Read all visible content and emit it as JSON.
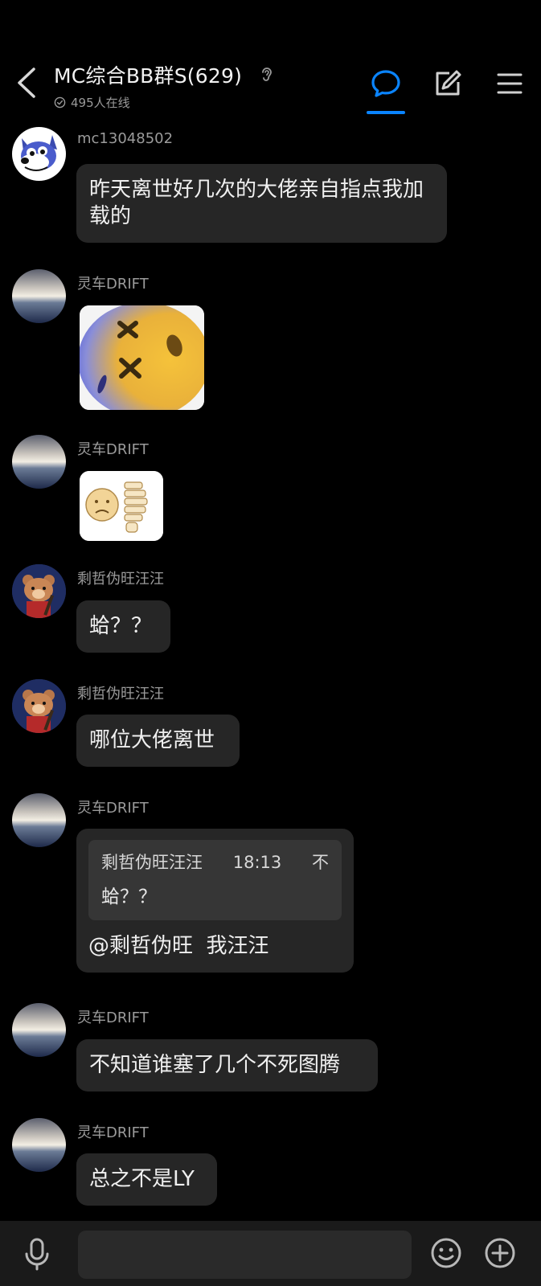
{
  "header": {
    "title": "MC综合BB群S(629)",
    "online": "495人在线"
  },
  "messages": [
    {
      "nick": "mc13048502",
      "text": "昨天离世好几次的大佬亲自指点我加载的"
    },
    {
      "nick": "灵车DRIFT",
      "sticker": "dead-face-emoji-sticker"
    },
    {
      "nick": "灵车DRIFT",
      "sticker": "skeleton-face-sticker"
    },
    {
      "nick": "剩哲伪旺汪汪",
      "text": "蛤？？"
    },
    {
      "nick": "剩哲伪旺汪汪",
      "text": "哪位大佬离世"
    },
    {
      "nick": "灵车DRIFT",
      "quote": {
        "author": "剩哲伪旺汪汪",
        "time": "18:13",
        "tail": "不",
        "text": "蛤？？"
      },
      "text": "@剩哲伪旺  我汪汪"
    },
    {
      "nick": "灵车DRIFT",
      "text": "不知道谁塞了几个不死图腾"
    },
    {
      "nick": "灵车DRIFT",
      "text": "总之不是LY"
    }
  ],
  "colors": {
    "accent": "#0a84ff",
    "bubble": "#262626",
    "background": "#000000"
  }
}
